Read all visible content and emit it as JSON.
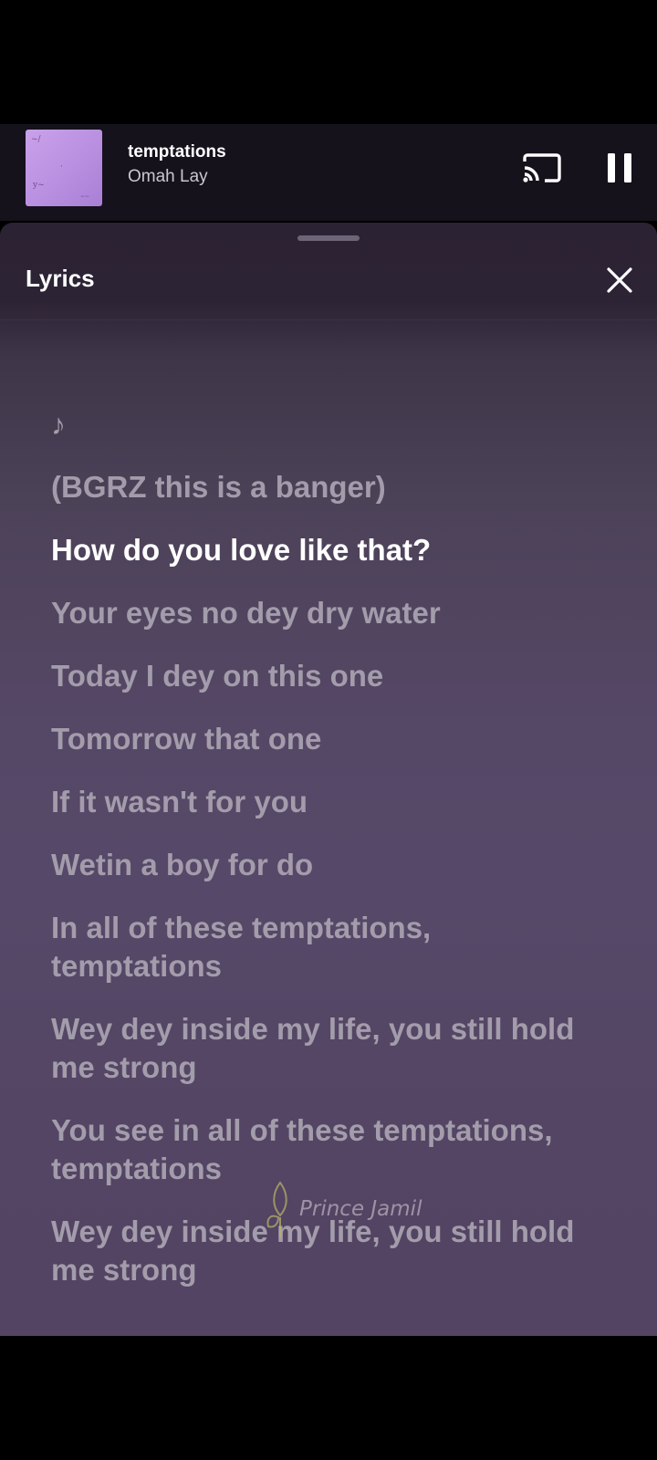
{
  "now_playing": {
    "title": "temptations",
    "artist": "Omah Lay",
    "icons": {
      "cast": "cast-icon",
      "pause": "pause-icon"
    }
  },
  "lyrics_sheet": {
    "title": "Lyrics",
    "close_icon": "close-icon",
    "lines": [
      {
        "text": "♪",
        "active": false
      },
      {
        "text": "(BGRZ this is a banger)",
        "active": false
      },
      {
        "text": "How do you love like that?",
        "active": true
      },
      {
        "text": "Your eyes no dey dry water",
        "active": false
      },
      {
        "text": "Today I dey on this one",
        "active": false
      },
      {
        "text": "Tomorrow that one",
        "active": false
      },
      {
        "text": "If it wasn't for you",
        "active": false
      },
      {
        "text": "Wetin a boy for do",
        "active": false
      },
      {
        "text": "In all of these temptations, temptations",
        "active": false
      },
      {
        "text": "Wey dey inside my life, you still hold me strong",
        "active": false
      },
      {
        "text": "You see in all of these temptations, temptations",
        "active": false
      },
      {
        "text": "Wey dey inside my life, you still hold me strong",
        "active": false
      }
    ]
  },
  "watermark": {
    "text": "Prince Jamil"
  },
  "colors": {
    "active_lyric": "#ffffff",
    "inactive_lyric": "#a39cab",
    "sheet_background": "#554766",
    "album_art": "#c9a2ea"
  }
}
